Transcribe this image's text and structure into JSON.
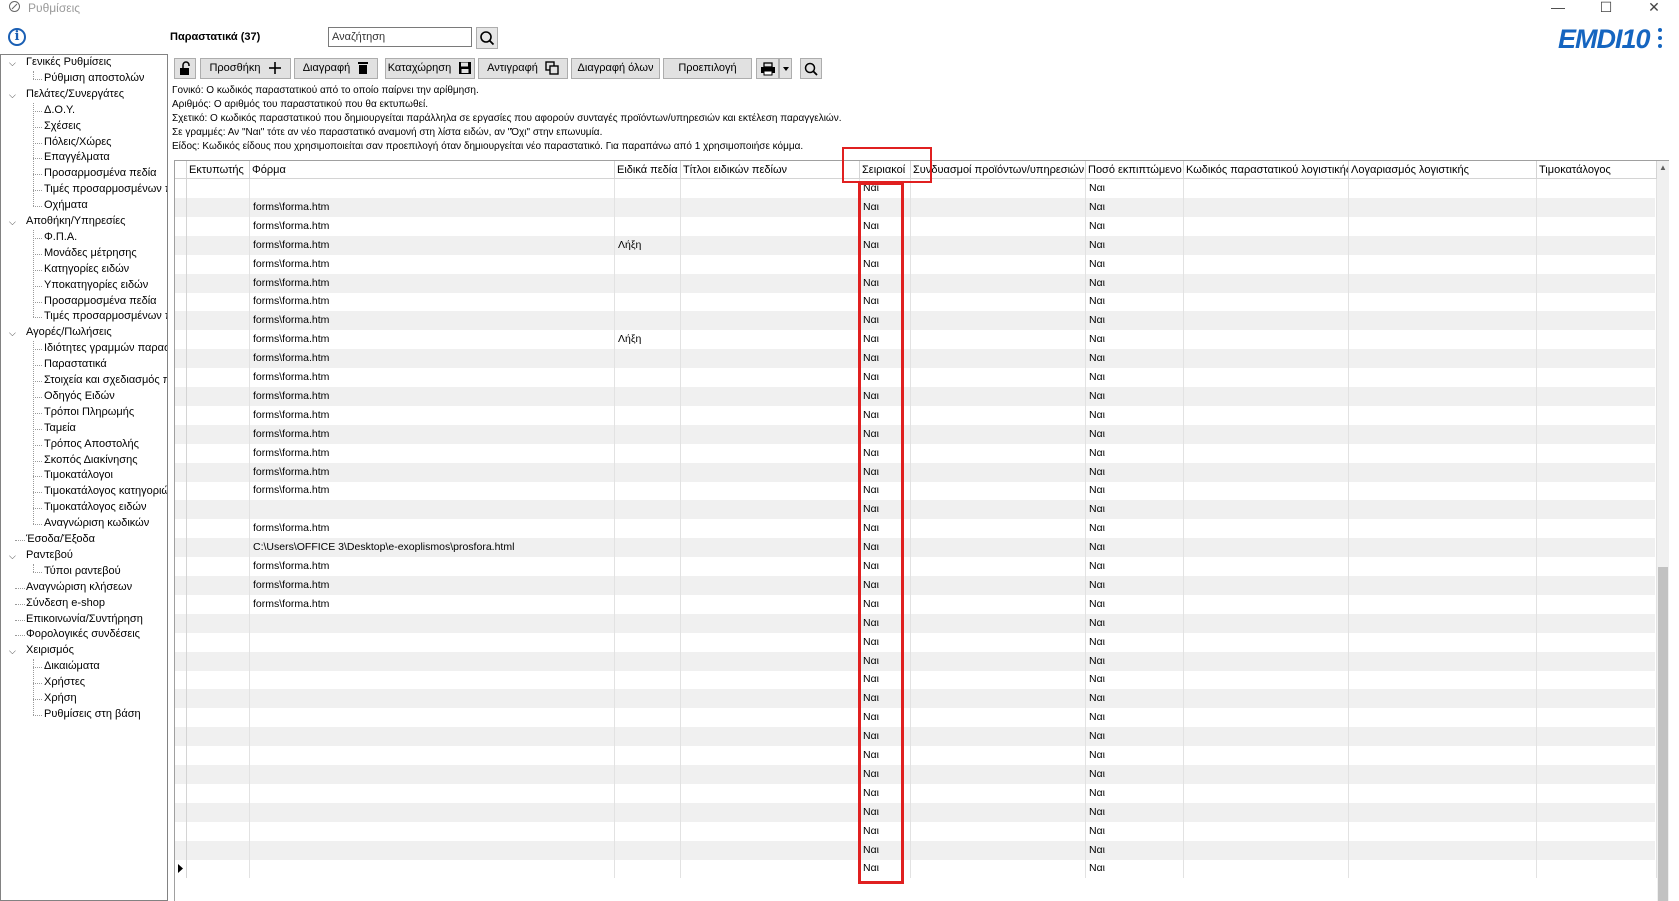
{
  "window": {
    "title": "Ρυθμίσεις",
    "minimize": "—",
    "maximize": "☐",
    "close": "✕"
  },
  "header": {
    "info_icon": "i",
    "title": "Παραστατικά (37)",
    "search_placeholder": "Αναζήτηση",
    "brand": "EMDI10"
  },
  "sidebar": {
    "groups": [
      {
        "label": "Γενικές Ρυθμίσεις",
        "children": [
          "Ρύθμιση αποστολών"
        ]
      },
      {
        "label": "Πελάτες/Συνεργάτες",
        "children": [
          "Δ.Ο.Υ.",
          "Σχέσεις",
          "Πόλεις/Χώρες",
          "Επαγγέλματα",
          "Προσαρμοσμένα πεδία",
          "Τιμές προσαρμοσμένων π",
          "Οχήματα"
        ]
      },
      {
        "label": "Αποθήκη/Υπηρεσίες",
        "children": [
          "Φ.Π.Α.",
          "Μονάδες μέτρησης",
          "Κατηγορίες ειδών",
          "Υποκατηγορίες ειδών",
          "Προσαρμοσμένα πεδία",
          "Τιμές προσαρμοσμένων π"
        ]
      },
      {
        "label": "Αγορές/Πωλήσεις",
        "children": [
          "Ιδιότητες γραμμών παραστ",
          "Παραστατικά",
          "Στοιχεία και σχεδιασμός π",
          "Οδηγός Ειδών",
          "Τρόποι Πληρωμής",
          "Ταμεία",
          "Τρόπος Αποστολής",
          "Σκοπός Διακίνησης",
          "Τιμοκατάλογοι",
          "Τιμοκατάλογος κατηγοριώ",
          "Τιμοκατάλογος ειδών",
          "Αναγνώριση κωδικών"
        ]
      },
      {
        "label": "Έσοδα/Έξοδα",
        "children": []
      },
      {
        "label": "Ραντεβού",
        "children": [
          "Τύποι ραντεβού"
        ]
      },
      {
        "label": "Αναγνώριση κλήσεων",
        "children": []
      },
      {
        "label": "Σύνδεση e-shop",
        "children": []
      },
      {
        "label": "Επικοινωνία/Συντήρηση",
        "children": []
      },
      {
        "label": "Φορολογικές συνδέσεις",
        "children": []
      },
      {
        "label": "Χειρισμός",
        "children": [
          "Δικαιώματα",
          "Χρήστες",
          "Χρήση",
          "Ρυθμίσεις στη βάση"
        ]
      }
    ]
  },
  "toolbar": {
    "add": "Προσθήκη",
    "delete": "Διαγραφή",
    "save": "Καταχώρηση",
    "copy": "Αντιγραφή",
    "delete_all": "Διαγραφή όλων",
    "default": "Προεπιλογή"
  },
  "help": [
    "Γονικό: Ο κωδικός παραστατικού από το οποίο παίρνει την αρίθμηση.",
    "Αριθμός: Ο αριθμός του παραστατικού που θα εκτυπωθεί.",
    "Σχετικό: Ο κωδικός παραστατικού που δημιουργείται παράλληλα σε εργασίες που αφορούν συνταγές προϊόντων/υπηρεσιών και εκτέλεση παραγγελιών.",
    "Σε γραμμές: Αν \"Ναι\" τότε αν νέο παραστατικό αναμονή στη λίστα ειδών, αν \"Όχι\" στην επωνυμία.",
    "Είδος: Κωδικός είδους που χρησιμοποιείται σαν προεπιλογή όταν δημιουργείται νέο παραστατικό. Για παραπάνω από 1 χρησιμοποιήσε κόμμα."
  ],
  "grid": {
    "columns": [
      "Εκτυπωτής",
      "Φόρμα",
      "Ειδικά πεδία",
      "Τίτλοι ειδικών πεδίων",
      "Σειριακοί",
      "Συνδυασμοί προϊόντων/υπηρεσιών",
      "Ποσό εκπιπτώμενο",
      "Κωδικός παραστατικού λογιστικής",
      "Λογαριασμός λογιστικής",
      "Τιμοκατάλογος"
    ],
    "rows": [
      {
        "form": "",
        "special": "",
        "serial": "Ναι",
        "deduct": "Ναι"
      },
      {
        "form": "forms\\forma.htm",
        "special": "",
        "serial": "Ναι",
        "deduct": "Ναι"
      },
      {
        "form": "forms\\forma.htm",
        "special": "",
        "serial": "Ναι",
        "deduct": "Ναι"
      },
      {
        "form": "forms\\forma.htm",
        "special": "Λήξη",
        "serial": "Ναι",
        "deduct": "Ναι"
      },
      {
        "form": "forms\\forma.htm",
        "special": "",
        "serial": "Ναι",
        "deduct": "Ναι"
      },
      {
        "form": "forms\\forma.htm",
        "special": "",
        "serial": "Ναι",
        "deduct": "Ναι"
      },
      {
        "form": "forms\\forma.htm",
        "special": "",
        "serial": "Ναι",
        "deduct": "Ναι"
      },
      {
        "form": "forms\\forma.htm",
        "special": "",
        "serial": "Ναι",
        "deduct": "Ναι"
      },
      {
        "form": "forms\\forma.htm",
        "special": "Λήξη",
        "serial": "Ναι",
        "deduct": "Ναι"
      },
      {
        "form": "forms\\forma.htm",
        "special": "",
        "serial": "Ναι",
        "deduct": "Ναι"
      },
      {
        "form": "forms\\forma.htm",
        "special": "",
        "serial": "Ναι",
        "deduct": "Ναι"
      },
      {
        "form": "forms\\forma.htm",
        "special": "",
        "serial": "Ναι",
        "deduct": "Ναι"
      },
      {
        "form": "forms\\forma.htm",
        "special": "",
        "serial": "Ναι",
        "deduct": "Ναι"
      },
      {
        "form": "forms\\forma.htm",
        "special": "",
        "serial": "Ναι",
        "deduct": "Ναι"
      },
      {
        "form": "forms\\forma.htm",
        "special": "",
        "serial": "Ναι",
        "deduct": "Ναι"
      },
      {
        "form": "forms\\forma.htm",
        "special": "",
        "serial": "Ναι",
        "deduct": "Ναι"
      },
      {
        "form": "forms\\forma.htm",
        "special": "",
        "serial": "Ναι",
        "deduct": "Ναι"
      },
      {
        "form": "",
        "special": "",
        "serial": "Ναι",
        "deduct": "Ναι"
      },
      {
        "form": "forms\\forma.htm",
        "special": "",
        "serial": "Ναι",
        "deduct": "Ναι"
      },
      {
        "form": "C:\\Users\\OFFICE 3\\Desktop\\e-exoplismos\\prosfora.html",
        "special": "",
        "serial": "Ναι",
        "deduct": "Ναι"
      },
      {
        "form": "forms\\forma.htm",
        "special": "",
        "serial": "Ναι",
        "deduct": "Ναι"
      },
      {
        "form": "forms\\forma.htm",
        "special": "",
        "serial": "Ναι",
        "deduct": "Ναι"
      },
      {
        "form": "forms\\forma.htm",
        "special": "",
        "serial": "Ναι",
        "deduct": "Ναι"
      },
      {
        "form": "",
        "special": "",
        "serial": "Ναι",
        "deduct": "Ναι"
      },
      {
        "form": "",
        "special": "",
        "serial": "Ναι",
        "deduct": "Ναι"
      },
      {
        "form": "",
        "special": "",
        "serial": "Ναι",
        "deduct": "Ναι"
      },
      {
        "form": "",
        "special": "",
        "serial": "Ναι",
        "deduct": "Ναι"
      },
      {
        "form": "",
        "special": "",
        "serial": "Ναι",
        "deduct": "Ναι"
      },
      {
        "form": "",
        "special": "",
        "serial": "Ναι",
        "deduct": "Ναι"
      },
      {
        "form": "",
        "special": "",
        "serial": "Ναι",
        "deduct": "Ναι"
      },
      {
        "form": "",
        "special": "",
        "serial": "Ναι",
        "deduct": "Ναι"
      },
      {
        "form": "",
        "special": "",
        "serial": "Ναι",
        "deduct": "Ναι"
      },
      {
        "form": "",
        "special": "",
        "serial": "Ναι",
        "deduct": "Ναι"
      },
      {
        "form": "",
        "special": "",
        "serial": "Ναι",
        "deduct": "Ναι"
      },
      {
        "form": "",
        "special": "",
        "serial": "Ναι",
        "deduct": "Ναι"
      },
      {
        "form": "",
        "special": "",
        "serial": "Ναι",
        "deduct": "Ναι"
      },
      {
        "form": "",
        "special": "",
        "serial": "Ναι",
        "deduct": "Ναι"
      }
    ]
  },
  "colors": {
    "accent": "#1565c0",
    "highlight": "#e02020"
  }
}
